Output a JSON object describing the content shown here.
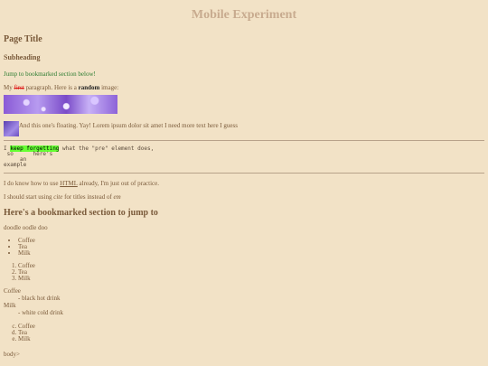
{
  "site_title": "Mobile Experiment",
  "page_title": "Page Title",
  "subheading": "Subheading",
  "jump_link": "Jump to bookmarked section below!",
  "para1": {
    "before": "My ",
    "strike": "first",
    "middle": " paragraph. Here is a ",
    "bold": "random",
    "after": " image:"
  },
  "float_text": "And this one's floating. Yay! Lorem ipsum dolor sit amet I need more text here I guess",
  "pre": {
    "prefix": "I ",
    "highlight": "keep forgetting",
    "rest": " what the \"pre\" element does,",
    "line2": " so      here's",
    "line3": "     an",
    "line4": "example"
  },
  "para2": {
    "before": "I do know how to use ",
    "abbr": "HTML",
    "after": " already, I'm just out of practice."
  },
  "para3": {
    "before": "I should start using ",
    "cite": "cite",
    "middle": " for titles instead of ",
    "em": "em"
  },
  "section_title": "Here's a bookmarked section to jump to",
  "doodle": "doodle oodle doo",
  "ul_items": [
    "Coffee",
    "Tea",
    "Milk"
  ],
  "ol_items": [
    "Coffee",
    "Tea",
    "Milk"
  ],
  "dl": [
    {
      "term": "Coffee",
      "desc": "- black hot drink"
    },
    {
      "term": "Milk",
      "desc": "- white cold drink"
    }
  ],
  "ol2_items": [
    "Coffee",
    "Tea",
    "Milk"
  ],
  "tail": "body>"
}
